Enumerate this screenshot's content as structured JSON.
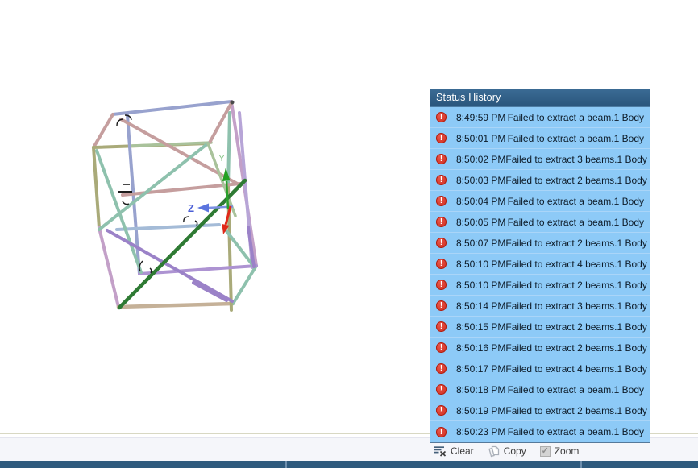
{
  "viewport": {
    "axes": {
      "z": "Z",
      "y": "Y"
    }
  },
  "status_history": {
    "title": "Status History",
    "rows": [
      {
        "time": "8:49:59 PM",
        "message": "Failed to extract a beam.",
        "scope": "1 Body"
      },
      {
        "time": "8:50:01 PM",
        "message": "Failed to extract a beam.",
        "scope": "1 Body"
      },
      {
        "time": "8:50:02 PM",
        "message": "Failed to extract 3 beams.",
        "scope": "1 Body"
      },
      {
        "time": "8:50:03 PM",
        "message": "Failed to extract 2 beams.",
        "scope": "1 Body"
      },
      {
        "time": "8:50:04 PM",
        "message": "Failed to extract a beam.",
        "scope": "1 Body"
      },
      {
        "time": "8:50:05 PM",
        "message": "Failed to extract a beam.",
        "scope": "1 Body"
      },
      {
        "time": "8:50:07 PM",
        "message": "Failed to extract 2 beams.",
        "scope": "1 Body"
      },
      {
        "time": "8:50:10 PM",
        "message": "Failed to extract 4 beams.",
        "scope": "1 Body"
      },
      {
        "time": "8:50:10 PM",
        "message": "Failed to extract 2 beams.",
        "scope": "1 Body"
      },
      {
        "time": "8:50:14 PM",
        "message": "Failed to extract 3 beams.",
        "scope": "1 Body"
      },
      {
        "time": "8:50:15 PM",
        "message": "Failed to extract 2 beams.",
        "scope": "1 Body"
      },
      {
        "time": "8:50:16 PM",
        "message": "Failed to extract 2 beams.",
        "scope": "1 Body"
      },
      {
        "time": "8:50:17 PM",
        "message": "Failed to extract 4 beams.",
        "scope": "1 Body"
      },
      {
        "time": "8:50:18 PM",
        "message": "Failed to extract a beam.",
        "scope": "1 Body"
      },
      {
        "time": "8:50:19 PM",
        "message": "Failed to extract 2 beams.",
        "scope": "1 Body"
      },
      {
        "time": "8:50:23 PM",
        "message": "Failed to extract a beam.",
        "scope": "1 Body"
      }
    ],
    "error_icon_glyph": "!",
    "toolbar": {
      "clear": "Clear",
      "copy": "Copy",
      "zoom": "Zoom"
    }
  },
  "colors": {
    "panel_header_bg": "#2e5c80",
    "panel_row_bg": "#8dcaf7",
    "error_red": "#d8392b",
    "statusbar_bg": "#2e5a7d",
    "axis_z_color": "#4a5ed6",
    "axis_y_color": "#2aa02a",
    "axis_x_color": "#e02818"
  }
}
